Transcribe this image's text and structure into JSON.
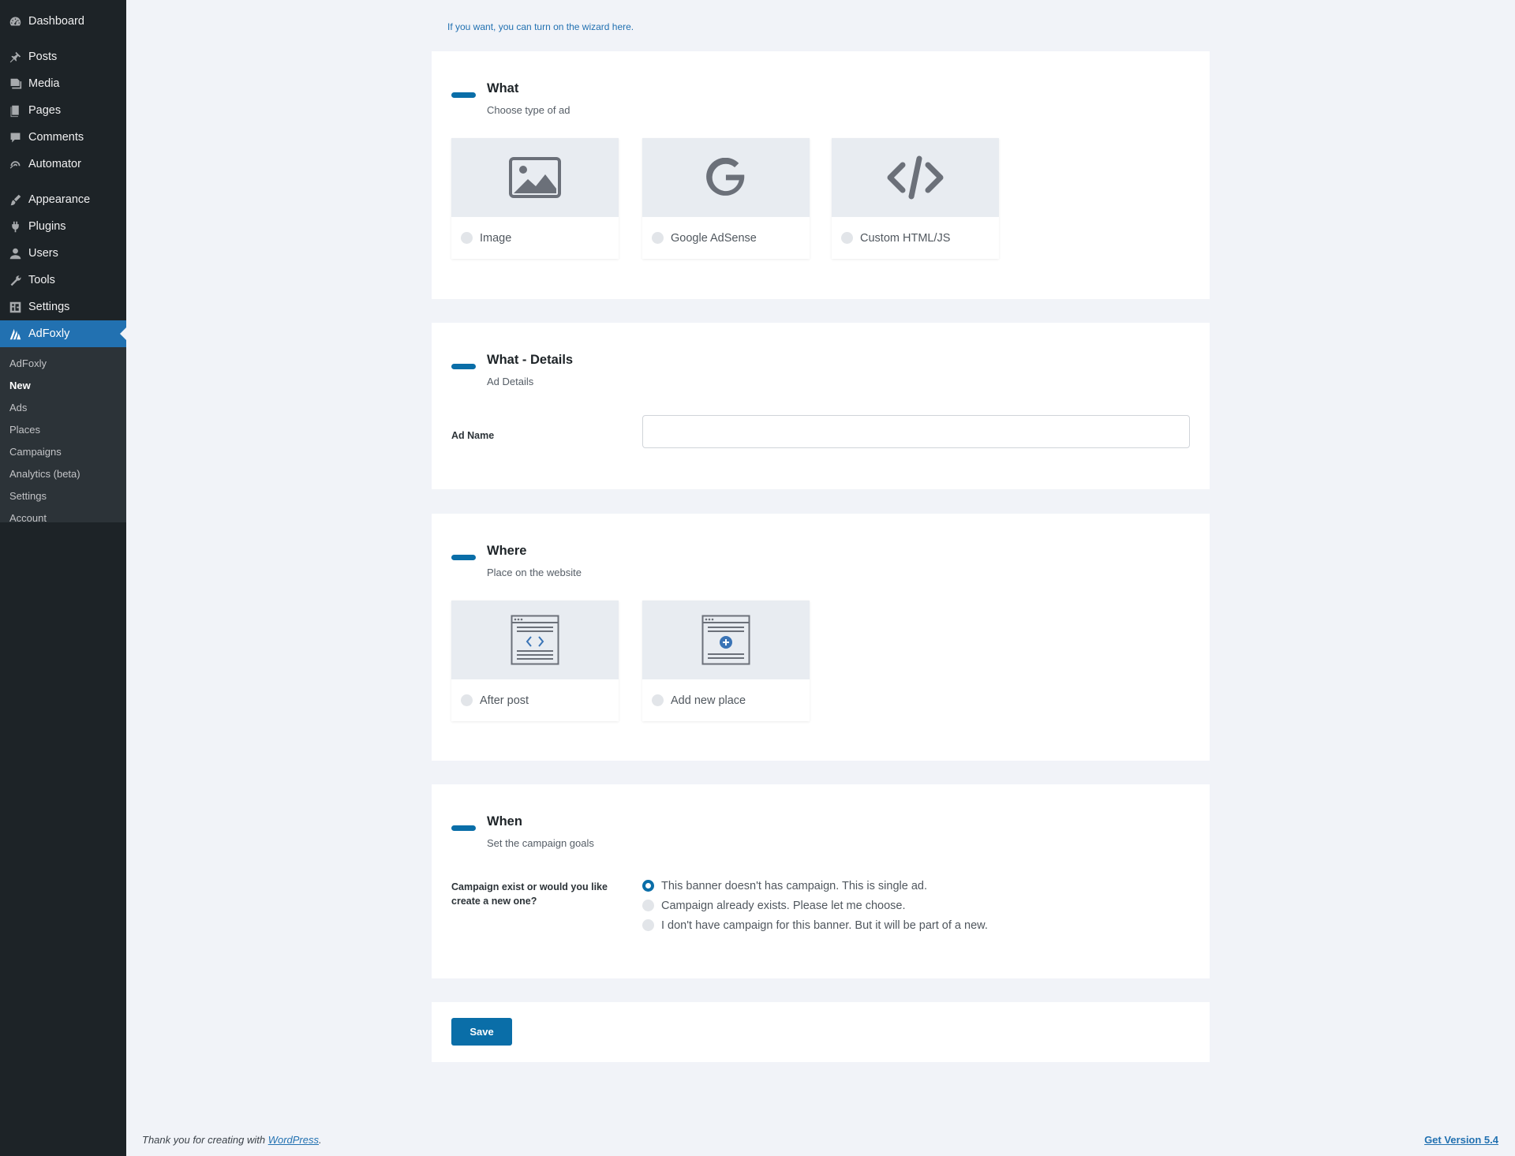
{
  "sidebar": {
    "items": [
      {
        "label": "Dashboard",
        "icon": "dashboard-icon"
      },
      {
        "label": "Posts",
        "icon": "pin-icon"
      },
      {
        "label": "Media",
        "icon": "media-icon"
      },
      {
        "label": "Pages",
        "icon": "pages-icon"
      },
      {
        "label": "Comments",
        "icon": "comments-icon"
      },
      {
        "label": "Automator",
        "icon": "automator-icon"
      },
      {
        "label": "Appearance",
        "icon": "brush-icon"
      },
      {
        "label": "Plugins",
        "icon": "plugin-icon"
      },
      {
        "label": "Users",
        "icon": "user-icon"
      },
      {
        "label": "Tools",
        "icon": "wrench-icon"
      },
      {
        "label": "Settings",
        "icon": "settings-icon"
      },
      {
        "label": "AdFoxly",
        "icon": "adfoxly-icon"
      }
    ],
    "submenu": [
      "AdFoxly",
      "New",
      "Ads",
      "Places",
      "Campaigns",
      "Analytics (beta)",
      "Settings",
      "Account"
    ]
  },
  "wizard_link": "If you want, you can turn on the wizard here.",
  "what": {
    "title": "What",
    "subtitle": "Choose type of ad",
    "options": [
      {
        "label": "Image",
        "icon": "image-icon"
      },
      {
        "label": "Google AdSense",
        "icon": "google-icon"
      },
      {
        "label": "Custom HTML/JS",
        "icon": "code-icon"
      }
    ]
  },
  "details": {
    "title": "What - Details",
    "subtitle": "Ad Details",
    "ad_name_label": "Ad Name",
    "ad_name_value": ""
  },
  "where": {
    "title": "Where",
    "subtitle": "Place on the website",
    "options": [
      {
        "label": "After post",
        "icon": "after-post-icon"
      },
      {
        "label": "Add new place",
        "icon": "add-place-icon"
      }
    ]
  },
  "when": {
    "title": "When",
    "subtitle": "Set the campaign goals",
    "question": "Campaign exist or would you like create a new one?",
    "choices": [
      "This banner doesn't has campaign. This is single ad.",
      "Campaign already exists. Please let me choose.",
      "I don't have campaign for this banner. But it will be part of a new."
    ],
    "selected_index": 0
  },
  "save_label": "Save",
  "footer": {
    "thanks_prefix": "Thank you for creating with ",
    "thanks_link": "WordPress",
    "thanks_suffix": ".",
    "version": "Get Version 5.4"
  },
  "colors": {
    "accent": "#0a6ea8",
    "sidebar_bg": "#1d2327",
    "active_menu": "#2271b1",
    "page_bg": "#f1f3f8"
  }
}
